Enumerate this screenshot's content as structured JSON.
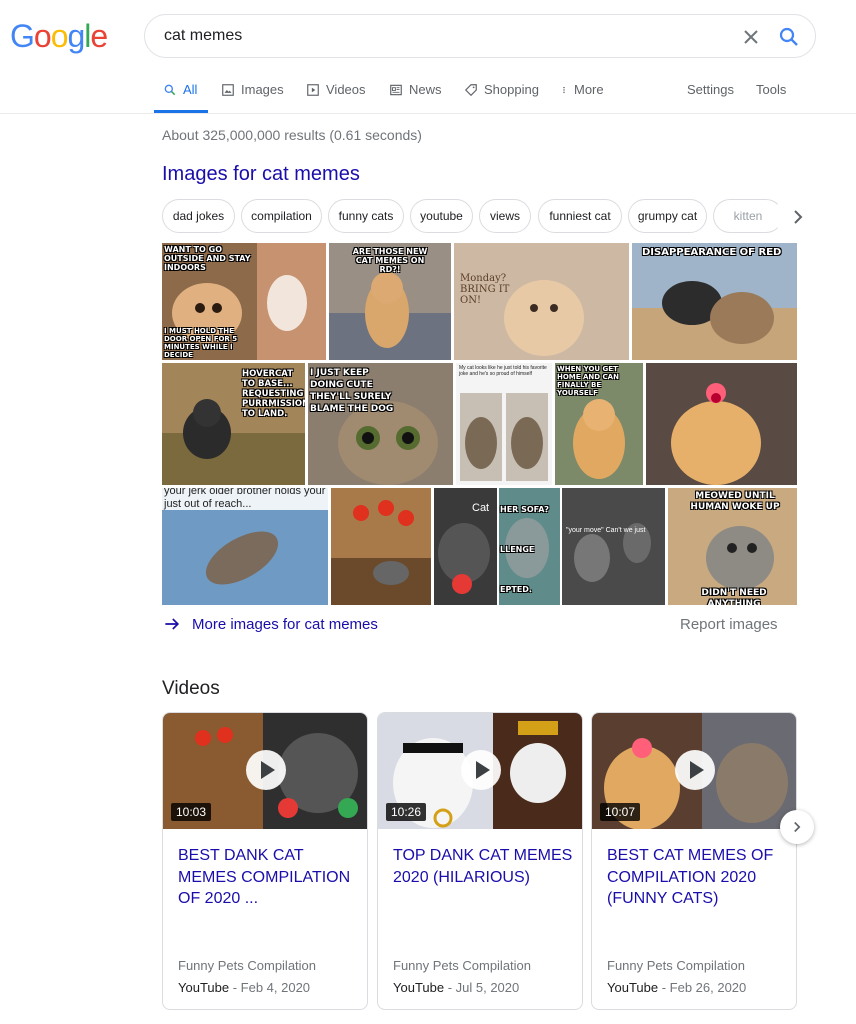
{
  "logo": {
    "letters": [
      "G",
      "o",
      "o",
      "g",
      "l",
      "e"
    ],
    "colors": [
      "#4285f4",
      "#ea4335",
      "#fbbc05",
      "#4285f4",
      "#34a853",
      "#ea4335"
    ]
  },
  "search": {
    "query": "cat memes",
    "clear_icon": "close-icon",
    "search_icon": "search-icon"
  },
  "tabs": [
    {
      "label": "All",
      "icon": "search-icon",
      "active": true
    },
    {
      "label": "Images",
      "icon": "image-icon"
    },
    {
      "label": "Videos",
      "icon": "video-icon"
    },
    {
      "label": "News",
      "icon": "newspaper-icon"
    },
    {
      "label": "Shopping",
      "icon": "tag-icon"
    },
    {
      "label": "More",
      "icon": "more-vert-icon"
    },
    {
      "label": "Settings"
    },
    {
      "label": "Tools"
    }
  ],
  "stats": "About 325,000,000 results (0.61 seconds)",
  "images": {
    "heading": "Images for cat memes",
    "chips": [
      "dad jokes",
      "compilation",
      "funny cats",
      "youtube",
      "views",
      "funniest cat",
      "grumpy cat",
      "kitten"
    ],
    "meme_texts": {
      "t1_top": "WANT TO GO OUTSIDE AND STAY INDOORS",
      "t1_bottom": "I MUST HOLD THE DOOR OPEN FOR 5 MINUTES WHILE I DECIDE",
      "t2": "ARE THOSE NEW CAT MEMES ON RD?!",
      "t3": "Monday? BRING IT ON!",
      "t4": "DISAPPEARANCE OF RED",
      "t5": "HOVERCAT TO BASE... REQUESTING PURRMISSION TO LAND.",
      "t6": "I JUST KEEP DOING CUTE THEY'LL SURELY BLAME THE DOG",
      "t7": "My cat looks like he just told his favorite joke and he's so proud of himself",
      "t8": "WHEN YOU GET HOME AND CAN FINALLY BE YOURSELF",
      "t9": "your jerk older brother holds your just out of reach...",
      "t10": "Cat",
      "t11": "her sofa? LLENGE EPTED.",
      "t12": "\"your move\" Can't we just throw them off like normal cats?",
      "t13": "MEOWED UNTIL HUMAN WOKE UP",
      "t13b": "DIDN'T NEED ANYTHING"
    },
    "more_label": "More images for cat memes",
    "report_label": "Report images"
  },
  "videos": {
    "heading": "Videos",
    "items": [
      {
        "duration": "10:03",
        "title": "BEST DANK CAT MEMES COMPILATION OF 2020 ...",
        "channel": "Funny Pets Compilation",
        "source": "YouTube",
        "date": " - Feb 4, 2020"
      },
      {
        "duration": "10:26",
        "title": "TOP DANK CAT MEMES 2020 (HILARIOUS)",
        "channel": "Funny Pets Compilation",
        "source": "YouTube",
        "date": " - Jul 5, 2020"
      },
      {
        "duration": "10:07",
        "title": "BEST CAT MEMES OF COMPILATION 2020 (FUNNY CATS)",
        "channel": "Funny Pets Compilation",
        "source": "YouTube",
        "date": " - Feb 26, 2020"
      }
    ]
  },
  "colors": {
    "link": "#1a0dab",
    "accent": "#1a73e8",
    "muted": "#70757a"
  }
}
